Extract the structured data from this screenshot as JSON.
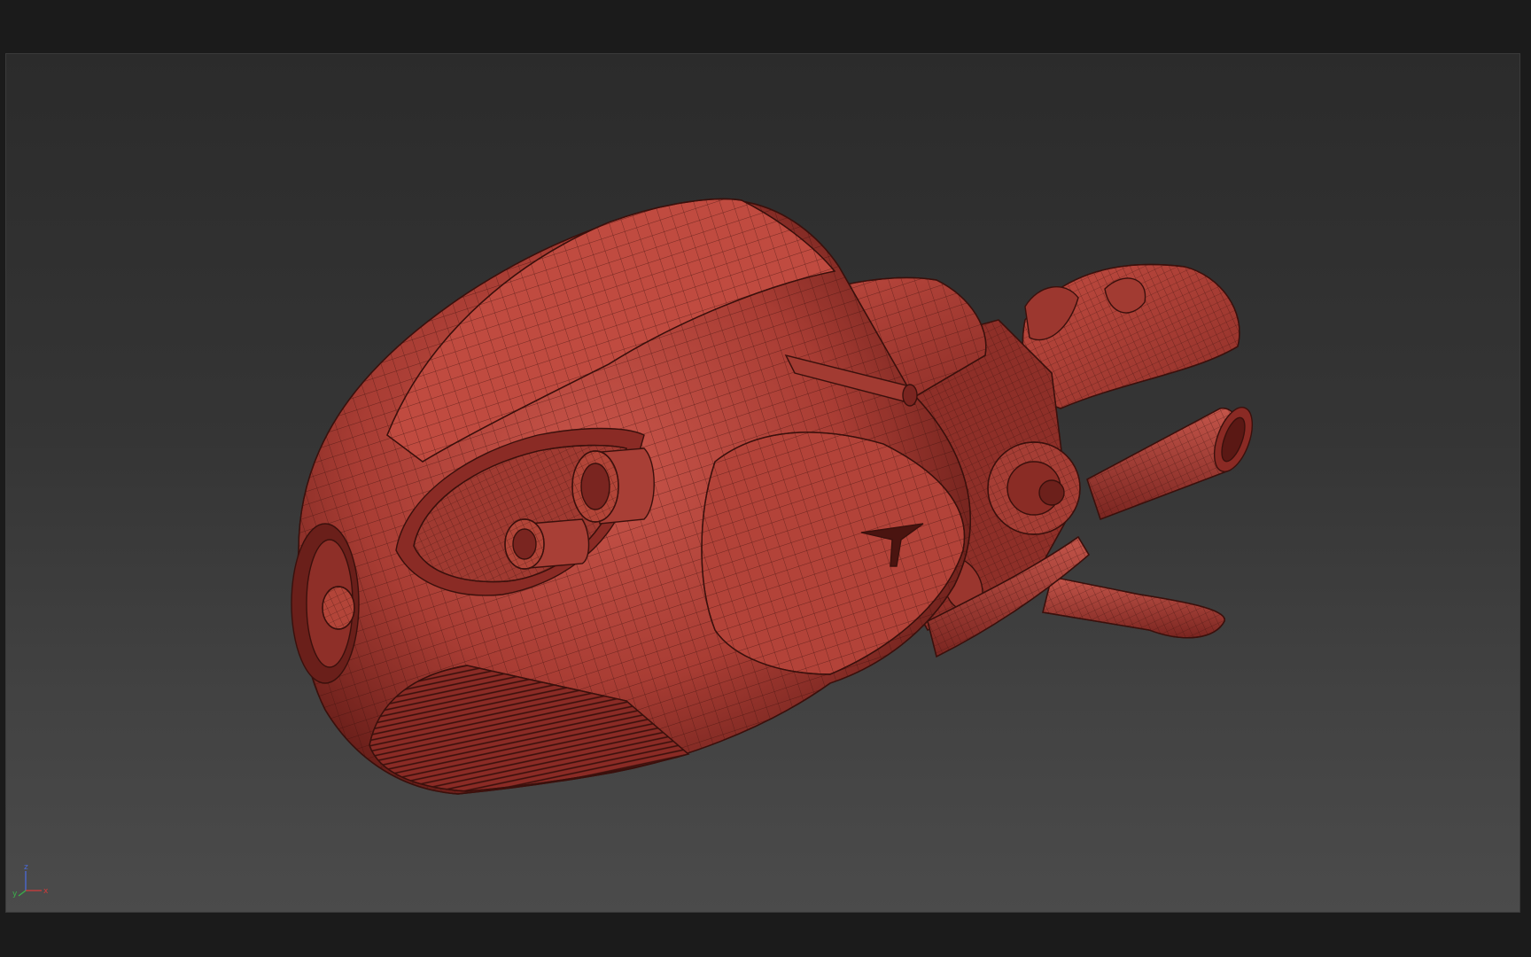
{
  "viewport": {
    "background_top": "#2b2b2b",
    "background_bottom": "#4b4b4b",
    "shading_mode": "wireframe-on-shaded",
    "model_color": "#b4433a",
    "wire_color": "#3a100c"
  },
  "axis_gizmo": {
    "x_label": "x",
    "y_label": "y",
    "z_label": "z",
    "x_color": "#d23a3a",
    "y_color": "#3ab04a",
    "z_color": "#4a6ad8"
  },
  "model": {
    "icon": "vehicle-model"
  }
}
